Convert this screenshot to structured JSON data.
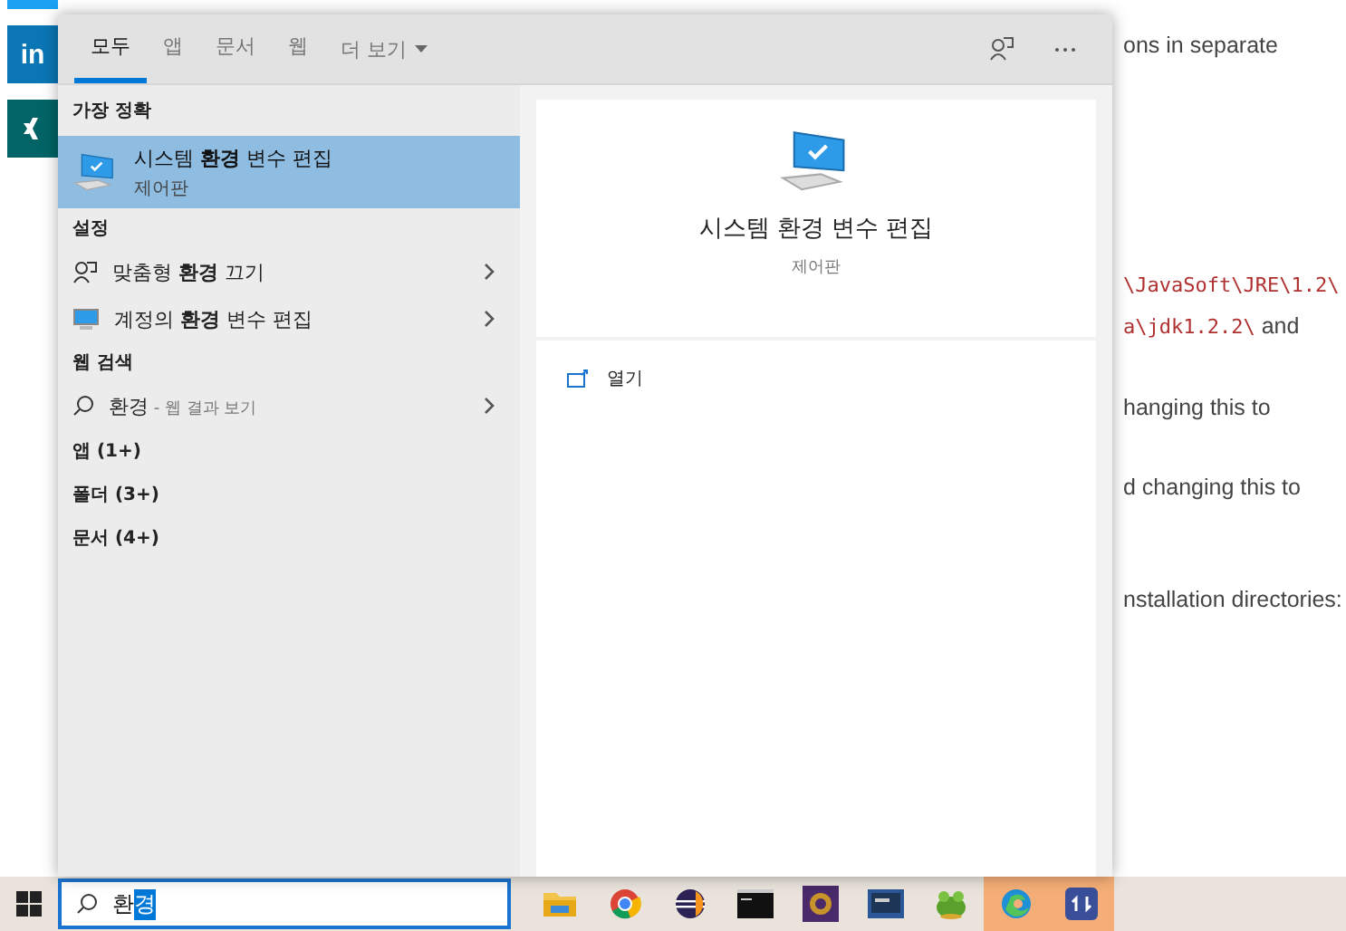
{
  "article": {
    "paragraphs": [
      [
        {
          "kind": "prose",
          "text": "ons in separate"
        }
      ],
      [
        {
          "kind": "code",
          "text": "\\JavaSoft\\JRE\\1.2\\"
        },
        {
          "kind": "code_prose",
          "code": "a\\jdk1.2.2\\",
          "text": " and"
        }
      ],
      [
        {
          "kind": "prose",
          "text": "hanging this to"
        }
      ],
      [
        {
          "kind": "prose",
          "text": "d changing this to"
        }
      ],
      [
        {
          "kind": "prose",
          "text": "nstallation directories:"
        }
      ]
    ]
  },
  "share_buttons": [
    {
      "kind": "twitter",
      "color": "#1da1f2"
    },
    {
      "kind": "linkedin",
      "color": "#0a76b4",
      "label": "in"
    },
    {
      "kind": "xing",
      "color": "#026466"
    }
  ],
  "search_panel": {
    "tabs": [
      {
        "label": "모두",
        "selected": true
      },
      {
        "label": "앱",
        "selected": false
      },
      {
        "label": "문서",
        "selected": false
      },
      {
        "label": "웹",
        "selected": false
      }
    ],
    "more": "더 보기",
    "best_match": {
      "heading": "가장 정확",
      "title": "시스템 **환경** 변수 편집",
      "subtitle": "제어판",
      "selected": true
    },
    "settings": {
      "heading": "설정",
      "items": [
        {
          "kind": "person",
          "label": "맞춤형 **환경** 끄기"
        },
        {
          "kind": "monitor",
          "label": "계정의 **환경** 변수 편집"
        }
      ]
    },
    "web": {
      "heading": "웹 검색",
      "query": "환경",
      "suffix": " - 웹 결과 보기"
    },
    "categories": [
      "앱 (1+)",
      "폴더 (3+)",
      "문서 (4+)"
    ],
    "preview": {
      "title": "시스템 환경 변수 편집",
      "subtitle": "제어판",
      "actions": [
        {
          "label": "열기"
        }
      ]
    }
  },
  "taskbar": {
    "query": [
      {
        "text": "환",
        "selected": false
      },
      {
        "text": "경",
        "selected": true
      }
    ],
    "apps": [
      {
        "kind": "folder",
        "highlighted": false
      },
      {
        "kind": "chrome",
        "highlighted": false
      },
      {
        "kind": "eclipse",
        "highlighted": false
      },
      {
        "kind": "terminal",
        "highlighted": false
      },
      {
        "kind": "game",
        "highlighted": false
      },
      {
        "kind": "screen",
        "highlighted": false
      },
      {
        "kind": "frog",
        "highlighted": false
      },
      {
        "kind": "edge",
        "highlighted": true
      },
      {
        "kind": "sync",
        "highlighted": true
      }
    ]
  }
}
